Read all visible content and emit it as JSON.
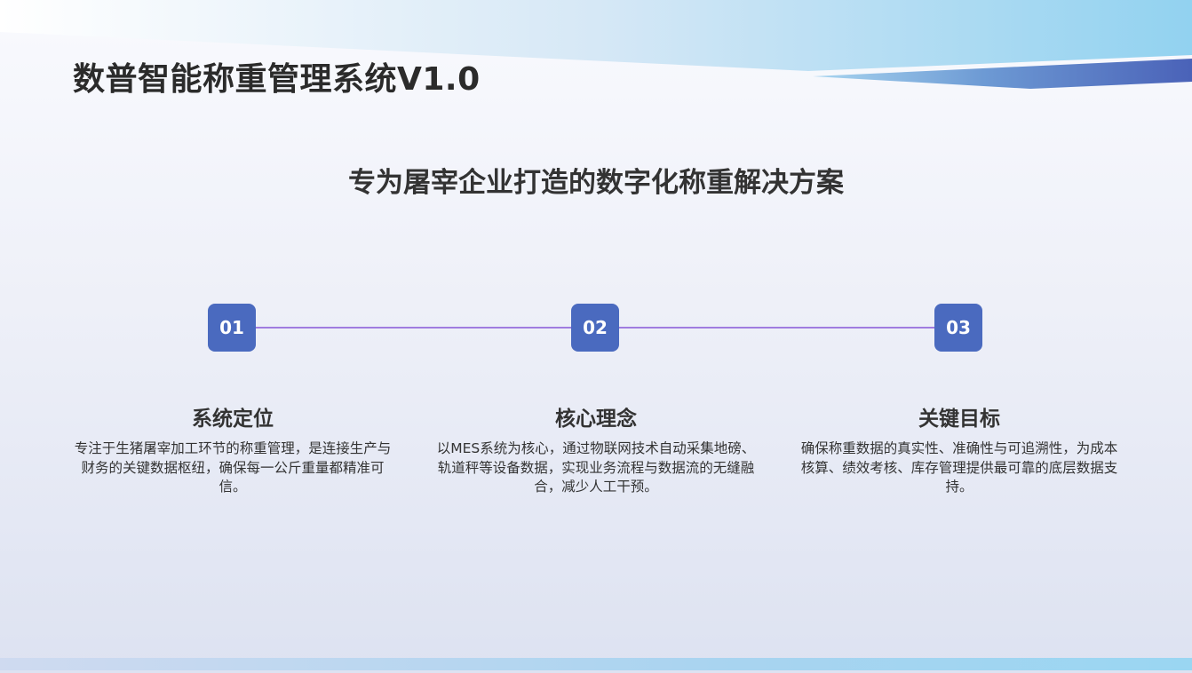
{
  "header": {
    "title": "数普智能称重管理系统V1.0"
  },
  "subtitle": "专为屠宰企业打造的数字化称重解决方案",
  "steps": [
    {
      "number": "01",
      "heading": "系统定位",
      "description": "专注于生猪屠宰加工环节的称重管理，是连接生产与财务的关键数据枢纽，确保每一公斤重量都精准可信。"
    },
    {
      "number": "02",
      "heading": "核心理念",
      "description": "以MES系统为核心，通过物联网技术自动采集地磅、轨道秤等设备数据，实现业务流程与数据流的无缝融合，减少人工干预。"
    },
    {
      "number": "03",
      "heading": "关键目标",
      "description": "确保称重数据的真实性、准确性与可追溯性，为成本核算、绩效考核、库存管理提供最可靠的底层数据支持。"
    }
  ],
  "colors": {
    "accent": "#4a6abf",
    "timeline": "#a07ce0",
    "text": "#333333"
  }
}
